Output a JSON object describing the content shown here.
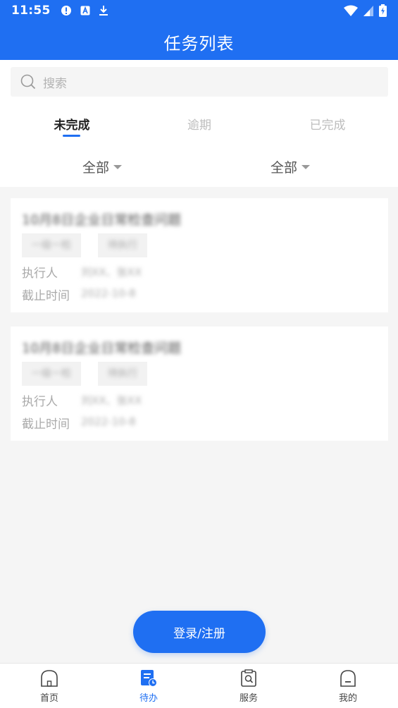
{
  "status_bar": {
    "time": "11:55",
    "left_icons": [
      "alert-circle-icon",
      "a-box-icon",
      "download-icon"
    ],
    "right_icons": [
      "wifi-icon",
      "signal-icon",
      "battery-charging-icon"
    ]
  },
  "header": {
    "title": "任务列表",
    "color": "#1f6ff2"
  },
  "search": {
    "placeholder": "搜索"
  },
  "tabs": [
    {
      "label": "未完成",
      "active": true
    },
    {
      "label": "逾期",
      "active": false
    },
    {
      "label": "已完成",
      "active": false
    }
  ],
  "filters": [
    {
      "label": "全部"
    },
    {
      "label": "全部"
    }
  ],
  "tasks": [
    {
      "title": "10月8日企业日常检查问题",
      "tags": [
        "一级一检",
        "待执行"
      ],
      "executor_label": "执行人",
      "executor": "刘XX、张XX",
      "deadline_label": "截止时间",
      "deadline": "2022-10-8"
    },
    {
      "title": "10月8日企业日常检查问题",
      "tags": [
        "一级一检",
        "待执行"
      ],
      "executor_label": "执行人",
      "executor": "刘XX、张XX",
      "deadline_label": "截止时间",
      "deadline": "2022-10-8"
    }
  ],
  "login_button": {
    "label": "登录/注册"
  },
  "bottom_nav": [
    {
      "label": "首页",
      "icon": "home-icon",
      "active": false
    },
    {
      "label": "待办",
      "icon": "todo-clock-icon",
      "active": true
    },
    {
      "label": "服务",
      "icon": "service-search-icon",
      "active": false
    },
    {
      "label": "我的",
      "icon": "profile-icon",
      "active": false
    }
  ]
}
